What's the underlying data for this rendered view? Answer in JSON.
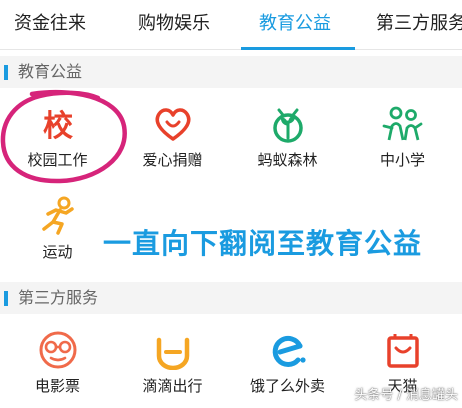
{
  "tabs": [
    {
      "label": "资金往来"
    },
    {
      "label": "购物娱乐"
    },
    {
      "label": "教育公益",
      "active": true
    },
    {
      "label": "第三方服务"
    }
  ],
  "sections": [
    {
      "title": "教育公益",
      "items": [
        {
          "label": "校园工作",
          "icon": "school-char-icon",
          "color": "#e8412b"
        },
        {
          "label": "爱心捐赠",
          "icon": "heart-icon",
          "color": "#e8412b"
        },
        {
          "label": "蚂蚁森林",
          "icon": "sprout-icon",
          "color": "#1eaa6a"
        },
        {
          "label": "中小学",
          "icon": "students-icon",
          "color": "#1eaa6a"
        },
        {
          "label": "运动",
          "icon": "runner-icon",
          "color": "#f5a623"
        }
      ]
    },
    {
      "title": "第三方服务",
      "items": [
        {
          "label": "电影票",
          "icon": "glasses-face-icon",
          "color": "#f06a4a"
        },
        {
          "label": "滴滴出行",
          "icon": "didi-icon",
          "color": "#f5a623"
        },
        {
          "label": "饿了么外卖",
          "icon": "eleme-icon",
          "color": "#1a9be0"
        },
        {
          "label": "天猫",
          "icon": "tmall-bag-icon",
          "color": "#e8412b"
        }
      ]
    }
  ],
  "annotation": {
    "text": "一直向下翻阅至教育公益",
    "color": "#1a9be0",
    "circle_color": "#d6247a"
  },
  "watermark": "头条号 / 消息罐头",
  "colors": {
    "accent": "#1a9be0"
  }
}
